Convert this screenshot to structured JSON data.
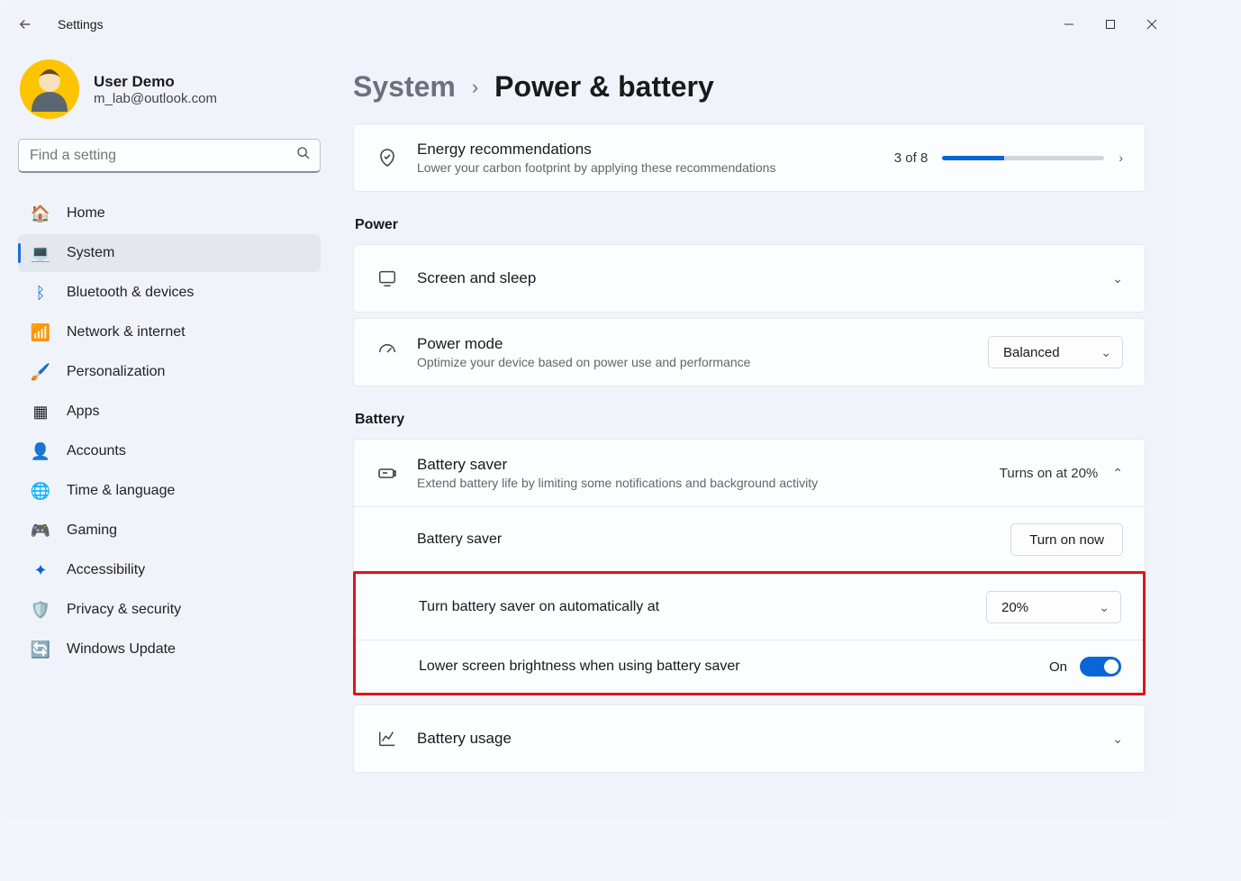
{
  "app": {
    "title": "Settings"
  },
  "user": {
    "name": "User Demo",
    "email": "m_lab@outlook.com"
  },
  "search": {
    "placeholder": "Find a setting"
  },
  "sidebar": {
    "items": [
      {
        "label": "Home"
      },
      {
        "label": "System"
      },
      {
        "label": "Bluetooth & devices"
      },
      {
        "label": "Network & internet"
      },
      {
        "label": "Personalization"
      },
      {
        "label": "Apps"
      },
      {
        "label": "Accounts"
      },
      {
        "label": "Time & language"
      },
      {
        "label": "Gaming"
      },
      {
        "label": "Accessibility"
      },
      {
        "label": "Privacy & security"
      },
      {
        "label": "Windows Update"
      }
    ]
  },
  "breadcrumb": {
    "parent": "System",
    "current": "Power & battery"
  },
  "energy": {
    "title": "Energy recommendations",
    "sub": "Lower your carbon footprint by applying these recommendations",
    "count": "3 of 8",
    "progress_pct": 38
  },
  "sections": {
    "power": "Power",
    "battery": "Battery"
  },
  "screen_sleep": {
    "title": "Screen and sleep"
  },
  "power_mode": {
    "title": "Power mode",
    "sub": "Optimize your device based on power use and performance",
    "value": "Balanced"
  },
  "battery_saver": {
    "title": "Battery saver",
    "sub": "Extend battery life by limiting some notifications and background activity",
    "status": "Turns on at 20%",
    "row1_label": "Battery saver",
    "row1_button": "Turn on now",
    "row2_label": "Turn battery saver on automatically at",
    "row2_value": "20%",
    "row3_label": "Lower screen brightness when using battery saver",
    "row3_toggle": "On"
  },
  "battery_usage": {
    "title": "Battery usage"
  }
}
